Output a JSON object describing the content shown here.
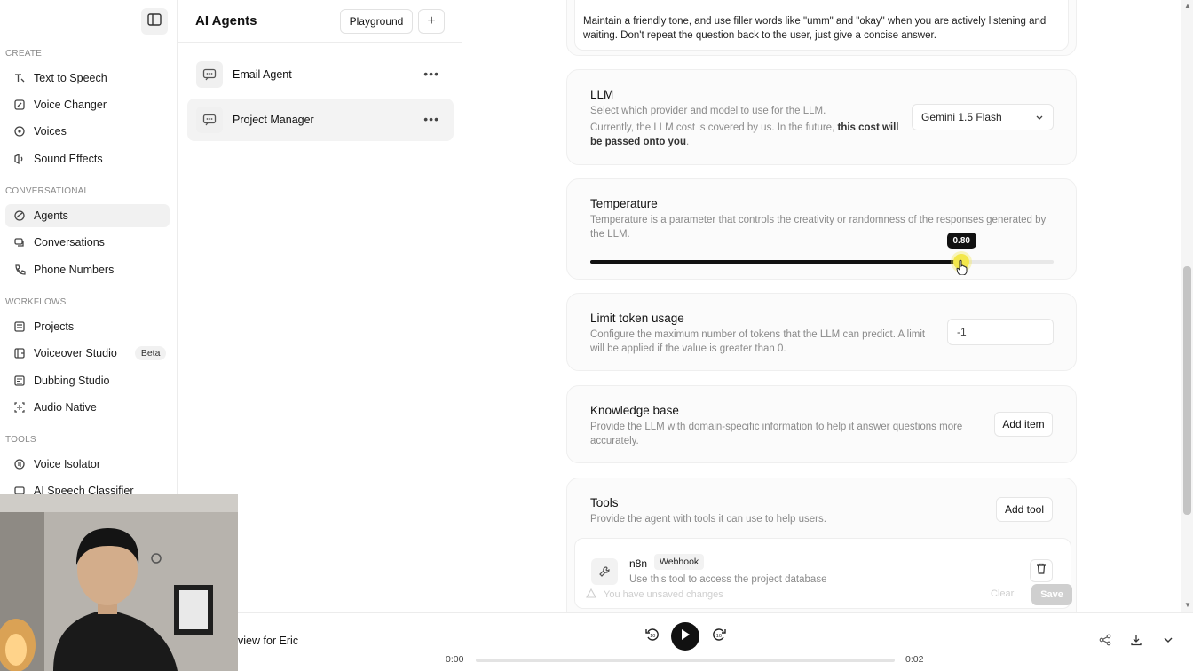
{
  "sidebar": {
    "sections": [
      {
        "title": "CREATE",
        "items": [
          {
            "label": "Text to Speech",
            "icon": "text-to-speech-icon"
          },
          {
            "label": "Voice Changer",
            "icon": "voice-changer-icon"
          },
          {
            "label": "Voices",
            "icon": "voices-icon"
          },
          {
            "label": "Sound Effects",
            "icon": "sound-effects-icon"
          }
        ]
      },
      {
        "title": "CONVERSATIONAL",
        "items": [
          {
            "label": "Agents",
            "icon": "agents-icon",
            "active": true
          },
          {
            "label": "Conversations",
            "icon": "conversations-icon"
          },
          {
            "label": "Phone Numbers",
            "icon": "phone-icon"
          }
        ]
      },
      {
        "title": "WORKFLOWS",
        "items": [
          {
            "label": "Projects",
            "icon": "projects-icon"
          },
          {
            "label": "Voiceover Studio",
            "icon": "voiceover-icon",
            "badge": "Beta"
          },
          {
            "label": "Dubbing Studio",
            "icon": "dubbing-icon"
          },
          {
            "label": "Audio Native",
            "icon": "audio-native-icon"
          }
        ]
      },
      {
        "title": "TOOLS",
        "items": [
          {
            "label": "Voice Isolator",
            "icon": "voice-isolator-icon"
          },
          {
            "label": "AI Speech Classifier",
            "icon": "classifier-icon"
          }
        ]
      }
    ]
  },
  "agents_panel": {
    "title": "AI Agents",
    "playground_label": "Playground",
    "add_label": "+",
    "agents": [
      {
        "name": "Email Agent",
        "active": false
      },
      {
        "name": "Project Manager",
        "active": true
      }
    ]
  },
  "main": {
    "prompt_text": "Maintain a friendly tone, and use filler words like \"umm\" and \"okay\" when you are actively listening and waiting. Don't repeat the question back to the user, just give a concise answer.",
    "llm": {
      "title": "LLM",
      "desc1": "Select which provider and model to use for the LLM.",
      "desc2_plain": "Currently, the LLM cost is covered by us. In the future,",
      "desc2_bold": "this cost will be passed onto you",
      "desc2_end": ".",
      "selected_model": "Gemini 1.5 Flash"
    },
    "temperature": {
      "title": "Temperature",
      "desc": "Temperature is a parameter that controls the creativity or randomness of the responses generated by the LLM.",
      "value_label": "0.80",
      "fraction": 0.8
    },
    "token_limit": {
      "title": "Limit token usage",
      "desc": "Configure the maximum number of tokens that the LLM can predict. A limit will be applied if the value is greater than 0.",
      "value": "-1"
    },
    "knowledge_base": {
      "title": "Knowledge base",
      "desc": "Provide the LLM with domain-specific information to help it answer questions more accurately.",
      "button_label": "Add item"
    },
    "tools": {
      "title": "Tools",
      "desc": "Provide the agent with tools it can use to help users.",
      "button_label": "Add tool",
      "items": [
        {
          "name": "n8n",
          "tag": "Webhook",
          "desc": "Use this tool to access the project database"
        }
      ],
      "unsaved_text": "You have unsaved changes",
      "clear_label": "Clear",
      "save_label": "Save"
    }
  },
  "player": {
    "title": "view for Eric",
    "time_current": "0:00",
    "time_total": "0:02",
    "skip_back": "10",
    "skip_forward": "10",
    "progress_fraction": 0.0
  },
  "colors": {
    "accent_thumb": "#f3e74b",
    "slider_fill": "#111111",
    "muted_text": "#8a8a8a"
  }
}
